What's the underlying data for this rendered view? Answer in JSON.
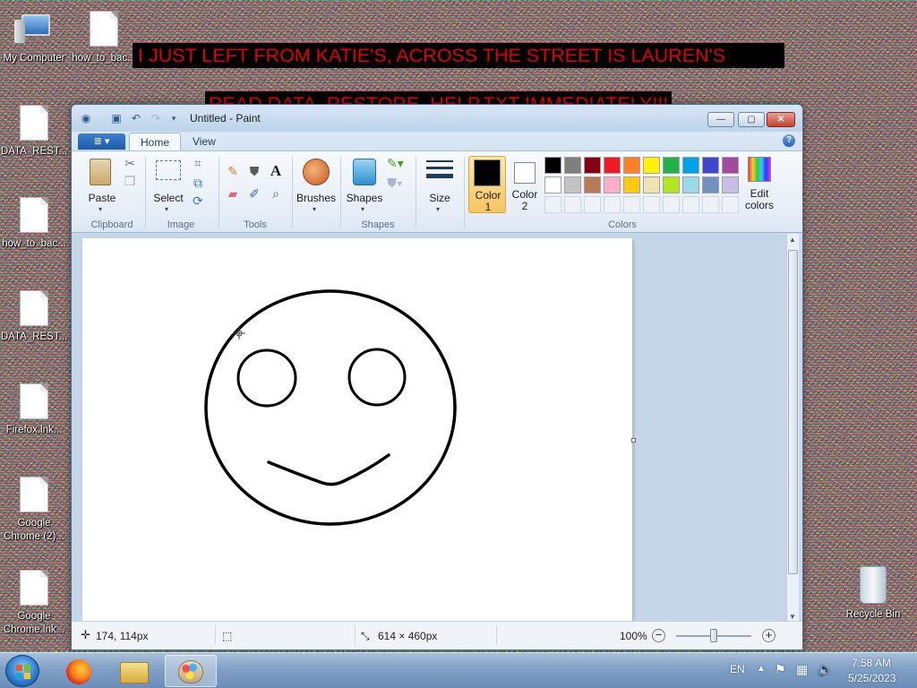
{
  "desktop": {
    "icons": [
      {
        "label": "My Computer"
      },
      {
        "label": "how_to_bac..."
      },
      {
        "label": "DATA_REST..."
      },
      {
        "label": "how_to_bac..."
      },
      {
        "label": "DATA_REST..."
      },
      {
        "label": "Firefox.lnk..."
      },
      {
        "label": "Google Chrome (2)..."
      },
      {
        "label": "Google Chrome.lnk..."
      },
      {
        "label": "Recycle Bin"
      }
    ],
    "banners": [
      "I JUST LEFT FROM KATIE'S, ACROSS THE STREET IS LAUREN'S",
      "READ DATA_RESTORE_HELP.TXT IMMEDIATELY!!!"
    ]
  },
  "window": {
    "title": "Untitled - Paint",
    "caption_buttons": {
      "minimize": "—",
      "maximize": "▢",
      "close": "✕"
    },
    "file_menu_icon": "file-menu-icon",
    "tabs": [
      {
        "label": "Home"
      },
      {
        "label": "View"
      }
    ],
    "help": "?"
  },
  "ribbon": {
    "groups": {
      "clipboard": "Clipboard",
      "image": "Image",
      "tools": "Tools",
      "shapes": "Shapes",
      "colors": "Colors"
    },
    "paste": "Paste",
    "select": "Select",
    "brushes": "Brushes",
    "shapes": "Shapes",
    "size": "Size",
    "color1": {
      "line1": "Color",
      "line2": "1",
      "value": "#000000"
    },
    "color2": {
      "line1": "Color",
      "line2": "2",
      "value": "#ffffff"
    },
    "edit_colors": {
      "line1": "Edit",
      "line2": "colors"
    },
    "palette_row1": [
      "#000000",
      "#7f7f7f",
      "#880015",
      "#ed1c24",
      "#ff7f27",
      "#fff200",
      "#22b14c",
      "#00a2e8",
      "#3f48cc",
      "#a349a4"
    ],
    "palette_row2": [
      "#ffffff",
      "#c3c3c3",
      "#b97a57",
      "#ffaec9",
      "#ffc90e",
      "#efe4b0",
      "#b5e61d",
      "#99d9ea",
      "#7092be",
      "#c8bfe7"
    ],
    "palette_row3": [
      "#eef1f5",
      "#eef1f5",
      "#eef1f5",
      "#eef1f5",
      "#eef1f5",
      "#eef1f5",
      "#eef1f5",
      "#eef1f5",
      "#eef1f5",
      "#eef1f5"
    ]
  },
  "status": {
    "cursor_pos": "174, 114px",
    "canvas_size": "614 × 460px",
    "zoom": "100%",
    "zoom_slider_fraction": 0.5
  },
  "taskbar": {
    "language": "EN",
    "time": "7:58 AM",
    "date": "5/25/2023"
  }
}
